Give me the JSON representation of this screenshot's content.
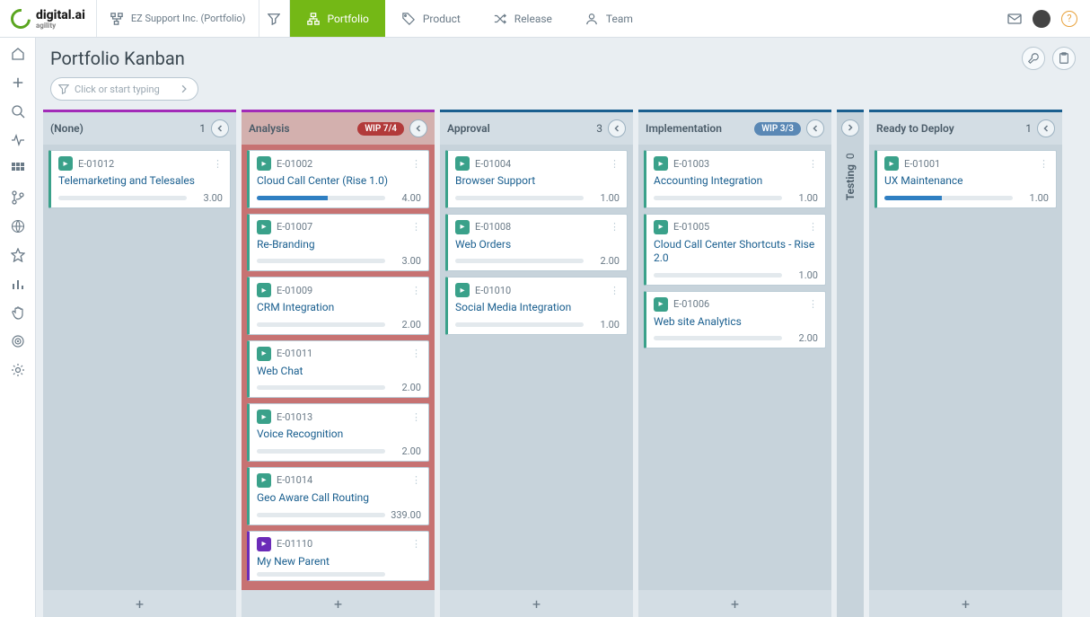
{
  "header": {
    "brand": "digital.ai",
    "brand_sub": "agility",
    "breadcrumb": "EZ Support Inc. (Portfolio)",
    "nav": [
      {
        "label": "Portfolio",
        "icon": "hierarchy-icon",
        "active": true
      },
      {
        "label": "Product",
        "icon": "tag-icon",
        "active": false
      },
      {
        "label": "Release",
        "icon": "shuffle-icon",
        "active": false
      },
      {
        "label": "Team",
        "icon": "person-icon",
        "active": false
      }
    ]
  },
  "page": {
    "title": "Portfolio Kanban",
    "filter_placeholder": "Click or start typing"
  },
  "columns": [
    {
      "name": "(None)",
      "selected": true,
      "count": 1,
      "wip": null,
      "cards": [
        {
          "id": "E-01012",
          "title": "Telemarketing and Telesales",
          "score": "3.00",
          "progress": 0
        }
      ]
    },
    {
      "name": "Analysis",
      "selected": true,
      "over": true,
      "wip": "WIP 7/4",
      "cards": [
        {
          "id": "E-01002",
          "title": "Cloud Call Center (Rise 1.0)",
          "score": "4.00",
          "progress": 55
        },
        {
          "id": "E-01007",
          "title": "Re-Branding",
          "score": "3.00",
          "progress": 0
        },
        {
          "id": "E-01009",
          "title": "CRM Integration",
          "score": "2.00",
          "progress": 0
        },
        {
          "id": "E-01011",
          "title": "Web Chat",
          "score": "2.00",
          "progress": 0
        },
        {
          "id": "E-01013",
          "title": "Voice Recognition",
          "score": "2.00",
          "progress": 0
        },
        {
          "id": "E-01014",
          "title": "Geo Aware Call Routing",
          "score": "339.00",
          "progress": 0
        },
        {
          "id": "E-01110",
          "title": "My New Parent",
          "score": "",
          "progress": 0,
          "purple": true
        }
      ]
    },
    {
      "name": "Approval",
      "count": 3,
      "wip": null,
      "cards": [
        {
          "id": "E-01004",
          "title": "Browser Support",
          "score": "1.00",
          "progress": 0
        },
        {
          "id": "E-01008",
          "title": "Web Orders",
          "score": "2.00",
          "progress": 0
        },
        {
          "id": "E-01010",
          "title": "Social Media Integration",
          "score": "1.00",
          "progress": 0
        }
      ]
    },
    {
      "name": "Implementation",
      "wip": "WIP 3/3",
      "wip_blue": true,
      "cards": [
        {
          "id": "E-01003",
          "title": "Accounting Integration",
          "score": "1.00",
          "progress": 0
        },
        {
          "id": "E-01005",
          "title": "Cloud Call Center Shortcuts - Rise 2.0",
          "score": "1.00",
          "progress": 0
        },
        {
          "id": "E-01006",
          "title": "Web site Analytics",
          "score": "2.00",
          "progress": 0
        }
      ]
    },
    {
      "name": "Testing",
      "collapsed": true,
      "count": 0
    },
    {
      "name": "Ready to Deploy",
      "count": 1,
      "cards": [
        {
          "id": "E-01001",
          "title": "UX Maintenance",
          "score": "1.00",
          "progress": 45
        }
      ]
    }
  ]
}
